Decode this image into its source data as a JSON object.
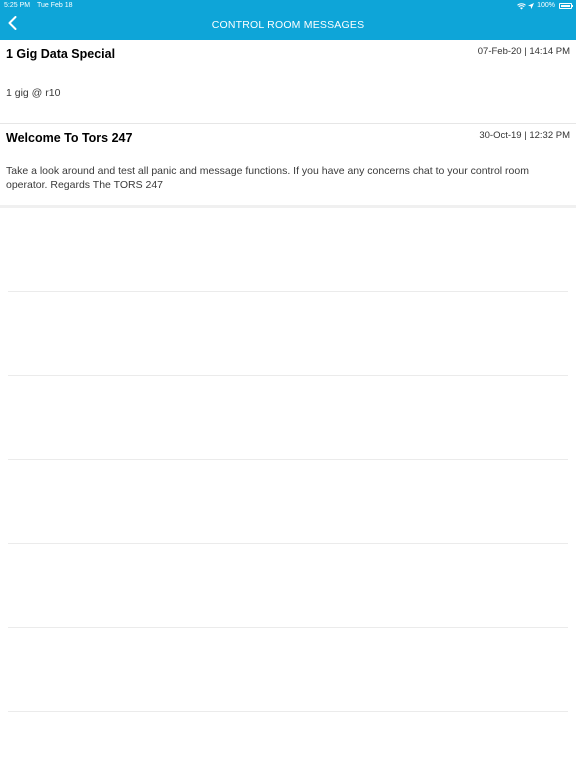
{
  "status_bar": {
    "time": "5:25 PM",
    "date": "Tue Feb 18",
    "battery_percent": "100%",
    "icons": [
      "wifi-icon",
      "location-arrow-icon",
      "battery-icon"
    ]
  },
  "header": {
    "title": "CONTROL ROOM MESSAGES",
    "back_icon": "chevron-left-icon"
  },
  "colors": {
    "header_bg": "#0ea5d8",
    "title_text": "#ffffff"
  },
  "messages": [
    {
      "title": "1 Gig Data Special",
      "date": "07-Feb-20 | 14:14 PM",
      "body": "1 gig @ r10"
    },
    {
      "title": "Welcome To Tors 247",
      "date": "30-Oct-19 | 12:32 PM",
      "body": "Take a look around and test all panic and message functions. If you have any concerns chat to your control room operator. Regards The TORS 247"
    }
  ]
}
